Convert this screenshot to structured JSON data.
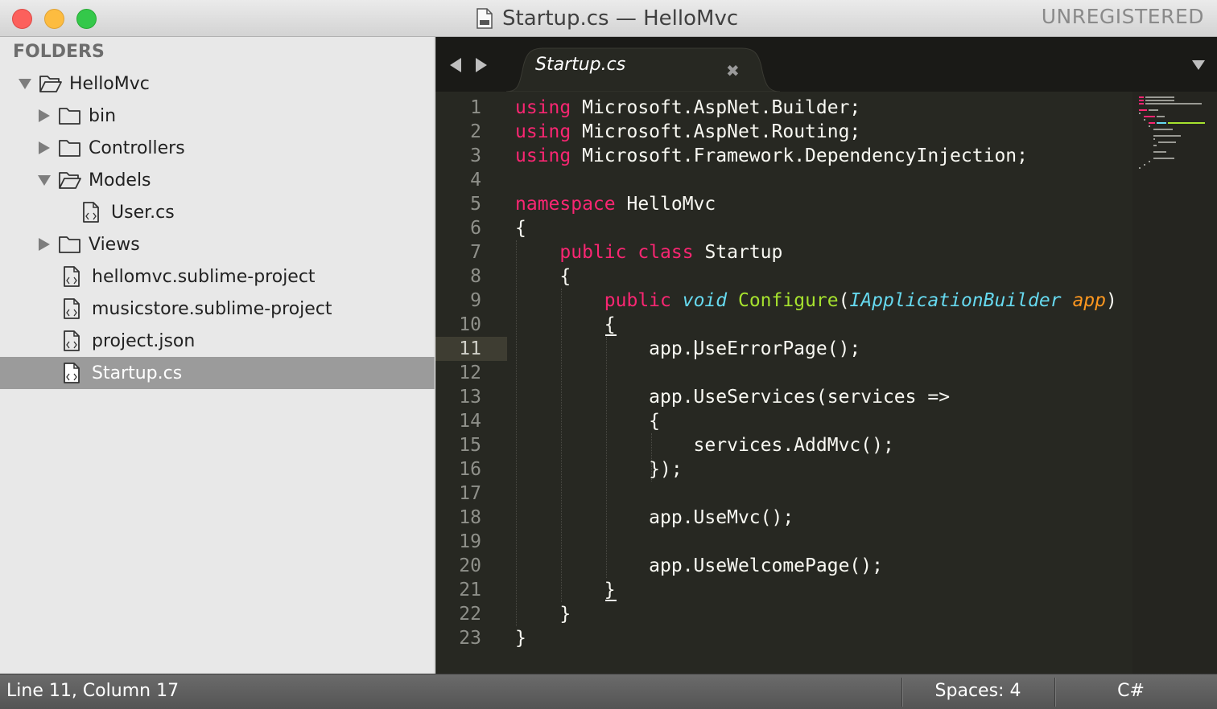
{
  "window": {
    "title": "Startup.cs — HelloMvc",
    "unregistered_label": "UNREGISTERED"
  },
  "sidebar": {
    "heading": "FOLDERS",
    "items": [
      {
        "label": "HelloMvc",
        "type": "folder",
        "expanded": true,
        "depth": 0
      },
      {
        "label": "bin",
        "type": "folder",
        "expanded": false,
        "depth": 1
      },
      {
        "label": "Controllers",
        "type": "folder",
        "expanded": false,
        "depth": 1
      },
      {
        "label": "Models",
        "type": "folder",
        "expanded": true,
        "depth": 1
      },
      {
        "label": "User.cs",
        "type": "file",
        "depth": 2
      },
      {
        "label": "Views",
        "type": "folder",
        "expanded": false,
        "depth": 1
      },
      {
        "label": "hellomvc.sublime-project",
        "type": "file",
        "depth": 1
      },
      {
        "label": "musicstore.sublime-project",
        "type": "file",
        "depth": 1
      },
      {
        "label": "project.json",
        "type": "file",
        "depth": 1
      },
      {
        "label": "Startup.cs",
        "type": "file",
        "depth": 1,
        "selected": true
      }
    ]
  },
  "editor": {
    "tab_label": "Startup.cs",
    "current_line": 11,
    "lines": [
      "using Microsoft.AspNet.Builder;",
      "using Microsoft.AspNet.Routing;",
      "using Microsoft.Framework.DependencyInjection;",
      "",
      "namespace HelloMvc",
      "{",
      "    public class Startup",
      "    {",
      "        public void Configure(IApplicationBuilder app)",
      "        {",
      "            app.UseErrorPage();",
      "",
      "            app.UseServices(services =>",
      "            {",
      "                services.AddMvc();",
      "            });",
      "",
      "            app.UseMvc();",
      "",
      "            app.UseWelcomePage();",
      "        }",
      "    }",
      "}"
    ]
  },
  "statusbar": {
    "position": "Line 11, Column 17",
    "spaces": "Spaces: 4",
    "syntax": "C#"
  },
  "colors": {
    "keyword": "#f92672",
    "storage_type": "#66d9ef",
    "function": "#a6e22e",
    "parameter": "#fd971f",
    "text": "#f8f8f2",
    "background": "#272822"
  }
}
